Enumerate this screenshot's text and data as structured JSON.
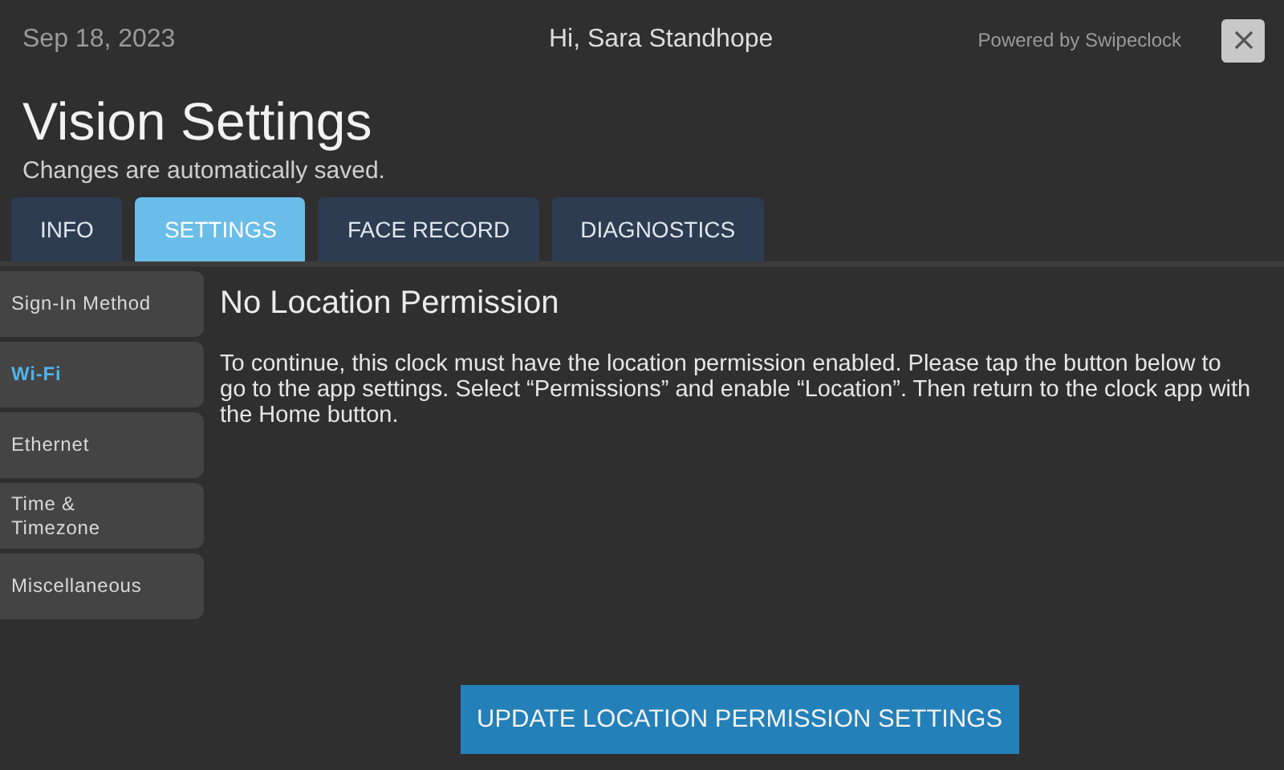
{
  "header": {
    "date": "Sep 18, 2023",
    "greeting": "Hi, Sara Standhope",
    "powered_by": "Powered by Swipeclock"
  },
  "title": "Vision Settings",
  "subtitle": "Changes are automatically saved.",
  "tabs": [
    {
      "label": "INFO",
      "selected": false
    },
    {
      "label": "SETTINGS",
      "selected": true
    },
    {
      "label": "FACE RECORD",
      "selected": false
    },
    {
      "label": "DIAGNOSTICS",
      "selected": false
    }
  ],
  "sidebar": {
    "items": [
      {
        "label": "Sign-In Method",
        "selected": false
      },
      {
        "label": "Wi-Fi",
        "selected": true
      },
      {
        "label": "Ethernet",
        "selected": false
      },
      {
        "label": "Time &\nTimezone",
        "selected": false
      },
      {
        "label": "Miscellaneous",
        "selected": false
      }
    ]
  },
  "content": {
    "heading": "No Location Permission",
    "message": "To continue, this clock must have the location permission enabled. Please tap the button below to go to the app settings. Select “Permissions” and enable “Location”. Then return to the clock app with the Home button.",
    "button": "UPDATE LOCATION PERMISSION SETTINGS"
  }
}
